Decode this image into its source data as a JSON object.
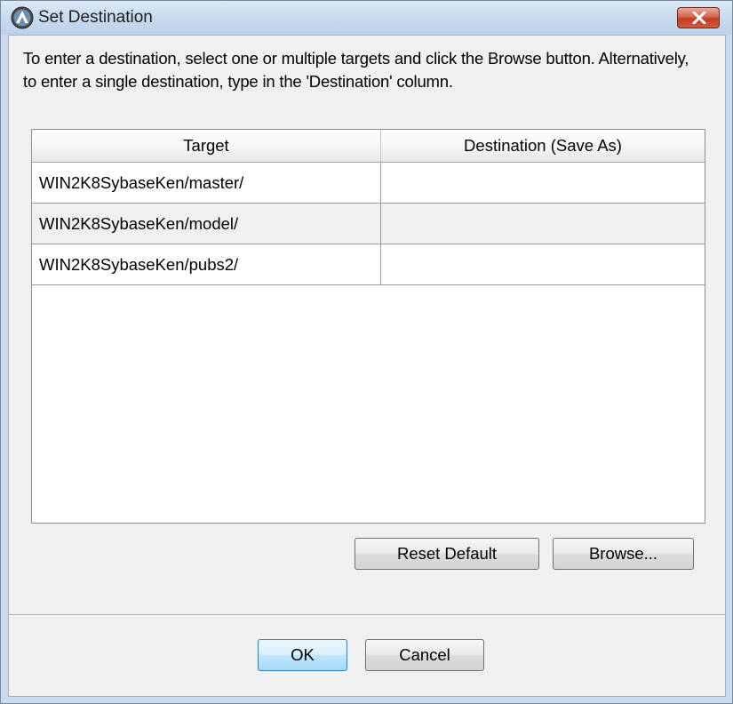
{
  "window": {
    "title": "Set Destination"
  },
  "instructions": "To enter a destination, select one or multiple targets and click the Browse button. Alternatively, to enter a single destination, type in the 'Destination' column.",
  "table": {
    "columns": [
      "Target",
      "Destination (Save As)"
    ],
    "rows": [
      {
        "target": "WIN2K8SybaseKen/master/",
        "destination": ""
      },
      {
        "target": "WIN2K8SybaseKen/model/",
        "destination": ""
      },
      {
        "target": "WIN2K8SybaseKen/pubs2/",
        "destination": ""
      }
    ]
  },
  "buttons": {
    "reset_default": "Reset Default",
    "browse": "Browse...",
    "ok": "OK",
    "cancel": "Cancel"
  },
  "icons": {
    "app": "app-logo-icon",
    "close": "close-icon"
  },
  "colors": {
    "title_bar": "#c7d9ee",
    "close_button": "#c9452b",
    "default_button_border": "#3c7fb1"
  }
}
